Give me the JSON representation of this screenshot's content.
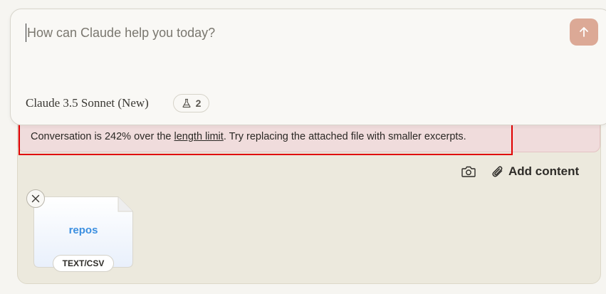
{
  "composer": {
    "placeholder": "How can Claude help you today?",
    "model_name": "Claude 3.5 Sonnet (New)",
    "beta_count": "2",
    "send_icon": "arrow-up-icon"
  },
  "warning": {
    "text_before": "Conversation is 242% over the ",
    "link_text": "length limit",
    "text_after": ". Try replacing the attached file with smaller excerpts."
  },
  "toolbar": {
    "camera_icon": "camera-icon",
    "add_content_icon": "paperclip-icon",
    "add_content_label": "Add content"
  },
  "attachments": [
    {
      "name": "repos",
      "type": "TEXT/CSV"
    }
  ],
  "colors": {
    "send_button": "#dca996",
    "warning_background": "#f0dcdc",
    "highlight_border": "#e00000",
    "file_name": "#3b8fe0",
    "tray_background": "#ece9dd"
  }
}
